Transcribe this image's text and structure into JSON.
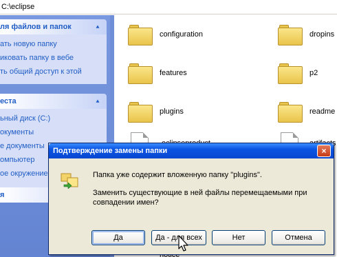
{
  "address": {
    "path": "C:\\eclipse"
  },
  "tasks_panel": {
    "title": "ля файлов и папок",
    "items": [
      "ать новую папку",
      "иковать папку в вебе",
      "ть общий доступ к этой"
    ]
  },
  "places_panel": {
    "title": "еста",
    "items": [
      "ьный диск (C:)",
      "окументы",
      "е документы",
      "омпьютер",
      "ое окружение"
    ]
  },
  "details_panel": {
    "title": "я"
  },
  "files": [
    {
      "name": "configuration",
      "type": "folder"
    },
    {
      "name": "dropins",
      "type": "folder"
    },
    {
      "name": "features",
      "type": "folder"
    },
    {
      "name": "p2",
      "type": "folder"
    },
    {
      "name": "plugins",
      "type": "folder"
    },
    {
      "name": "readme",
      "type": "folder"
    },
    {
      "name": ".eclipseproduct",
      "type": "file"
    },
    {
      "name": "artifacts",
      "type": "file"
    },
    {
      "name": "notice",
      "type": "file"
    }
  ],
  "dialog": {
    "title": "Подтверждение замены папки",
    "close": "×",
    "message_line1": "Папка уже содержит вложенную папку \"plugins\".",
    "message_line2": "Заменить существующие в ней файлы перемещаемыми при",
    "message_line3": "совпадении имен?",
    "buttons": {
      "yes": "Да",
      "yes_all": "Да - для всех",
      "no": "Нет",
      "cancel": "Отмена"
    }
  },
  "colors": {
    "titlebar": "#0a54e3",
    "dialog_bg": "#ece9d8",
    "taskpane": "#6384d2",
    "link": "#215dc6"
  }
}
